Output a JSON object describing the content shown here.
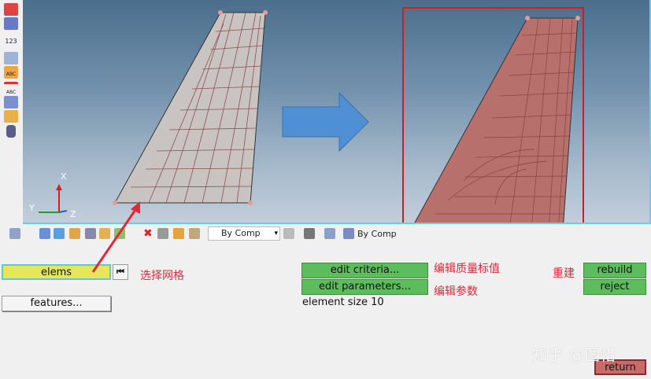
{
  "left_toolbar": {
    "icons": [
      "display-icon",
      "wheel-icon",
      "numbers-icon",
      "graph-icon",
      "abc-icon",
      "abc-outline-icon",
      "contour-icon",
      "layer-icon",
      "cylinder-icon"
    ],
    "number_label": "123",
    "abc_label": "ABC",
    "abc_label2": "ABC"
  },
  "viewport": {
    "background_top": "#4b6e8c",
    "background_bottom": "#c2cedb",
    "axis": {
      "x_label": "X",
      "y_label": "Y",
      "z_label": "Z"
    },
    "mesh_left_color": "#c9c4c2",
    "mesh_right_color": "#b8706d",
    "highlight_box_color": "#cc2020",
    "arrow_color": "#4f8fd3"
  },
  "toolbar2": {
    "dropdown1": "By Comp",
    "dropdown2": "By Comp"
  },
  "panel": {
    "elems_button": "elems",
    "features_button": "features...",
    "edit_criteria_button": "edit criteria...",
    "edit_parameters_button": "edit parameters...",
    "element_size_label": "element size",
    "element_size_value": "10",
    "rebuild_button": "rebuild",
    "reject_button": "reject",
    "return_button": "return"
  },
  "annotations": {
    "select_mesh": "选择网格",
    "edit_quality": "编辑质量标值",
    "edit_params": "编辑参数",
    "rebuild": "重建",
    "watermark": "知乎 @图惜"
  }
}
